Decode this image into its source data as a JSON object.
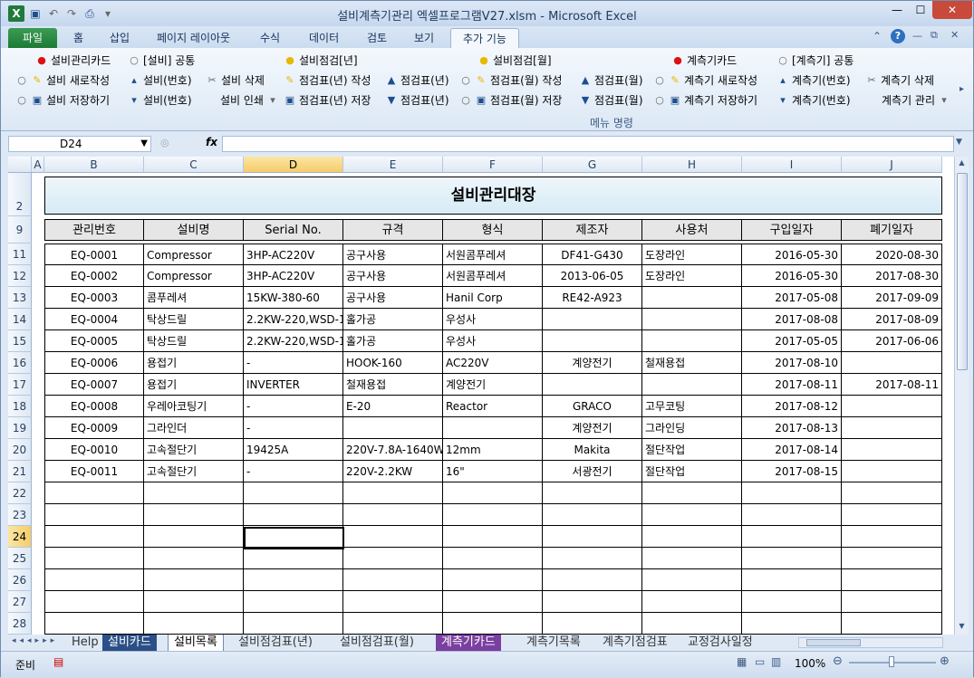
{
  "window": {
    "title": "설비계측기관리 엑셀프로그램V27.xlsm  -  Microsoft Excel"
  },
  "menu": {
    "tabs": [
      "파일",
      "홈",
      "삽입",
      "페이지 레이아웃",
      "수식",
      "데이터",
      "검토",
      "보기",
      "추가 기능"
    ]
  },
  "ribbon": {
    "row1": [
      "설비관리카드",
      "[설비] 공통",
      "설비점검[년]",
      "설비점검[월]",
      "계측기카드",
      "[계측기] 공통"
    ],
    "row2": [
      "설비 새로작성",
      "설비(번호)",
      "설비 삭제",
      "점검표(년) 작성",
      "점검표(년)",
      "점검표(월) 작성",
      "점검표(월)",
      "계측기 새로작성",
      "계측기(번호)",
      "계측기 삭제"
    ],
    "row3": [
      "설비 저장하기",
      "설비(번호)",
      "설비 인쇄",
      "점검표(년) 저장",
      "점검표(년)",
      "점검표(월) 저장",
      "점검표(월)",
      "계측기 저장하기",
      "계측기(번호)",
      "계측기 관리"
    ],
    "group_label": "메뉴 명령"
  },
  "formula_bar": {
    "name_box": "D24",
    "fx": "fx",
    "content": ""
  },
  "columns": [
    "A",
    "B",
    "C",
    "D",
    "E",
    "F",
    "G",
    "H",
    "I",
    "J"
  ],
  "sheet": {
    "title": "설비관리대장",
    "headers": [
      "관리번호",
      "설비명",
      "Serial No.",
      "규격",
      "형식",
      "제조자",
      "사용처",
      "구입일자",
      "폐기일자"
    ],
    "rows": [
      [
        "EQ-0001",
        "Compressor",
        "3HP-AC220V",
        "공구사용",
        "서원콤푸레셔",
        "DF41-G430",
        "도장라인",
        "2016-05-30",
        "2020-08-30"
      ],
      [
        "EQ-0002",
        "Compressor",
        "3HP-AC220V",
        "공구사용",
        "서원콤푸레셔",
        "2013-06-05",
        "도장라인",
        "2016-05-30",
        "2017-08-30"
      ],
      [
        "EQ-0003",
        "콤푸레셔",
        "15KW-380-60",
        "공구사용",
        "Hanil Corp",
        "RE42-A923",
        "",
        "2017-05-08",
        "2017-09-09"
      ],
      [
        "EQ-0004",
        "탁상드릴",
        "2.2KW-220,WSD-1",
        "홀가공",
        "우성사",
        "",
        "",
        "2017-08-08",
        "2017-08-09"
      ],
      [
        "EQ-0005",
        "탁상드릴",
        "2.2KW-220,WSD-1",
        "홀가공",
        "우성사",
        "",
        "",
        "2017-05-05",
        "2017-06-06"
      ],
      [
        "EQ-0006",
        "용접기",
        "-",
        "HOOK-160",
        "AC220V",
        "계양전기",
        "철재용접",
        "2017-08-10",
        ""
      ],
      [
        "EQ-0007",
        "용접기",
        "INVERTER",
        "철재용접",
        "계양전기",
        "",
        "",
        "2017-08-11",
        "2017-08-11"
      ],
      [
        "EQ-0008",
        "우레아코팅기",
        "-",
        "E-20",
        "Reactor",
        "GRACO",
        "고무코팅",
        "2017-08-12",
        ""
      ],
      [
        "EQ-0009",
        "그라인더",
        "-",
        "",
        "",
        "계양전기",
        "그라인딩",
        "2017-08-13",
        ""
      ],
      [
        "EQ-0010",
        "고속절단기",
        "19425A",
        "220V-7.8A-1640W",
        "12mm",
        "Makita",
        "절단작업",
        "2017-08-14",
        ""
      ],
      [
        "EQ-0011",
        "고속절단기",
        "-",
        "220V-2.2KW",
        "16\"",
        "서광전기",
        "절단작업",
        "2017-08-15",
        ""
      ]
    ],
    "row_numbers": [
      "2",
      "9",
      "11",
      "12",
      "13",
      "14",
      "15",
      "16",
      "17",
      "18",
      "19",
      "20",
      "21",
      "22",
      "23",
      "24",
      "25",
      "26",
      "27",
      "28"
    ]
  },
  "sheet_tabs": [
    "Help",
    "설비카드",
    "설비목록",
    "설비점검표(년)",
    "설비점검표(월)",
    "계측기카드",
    "계측기목록",
    "계측기점검표",
    "교정검사일정"
  ],
  "active_sheet": "설비목록",
  "status": {
    "ready": "준비",
    "zoom": "100%"
  }
}
